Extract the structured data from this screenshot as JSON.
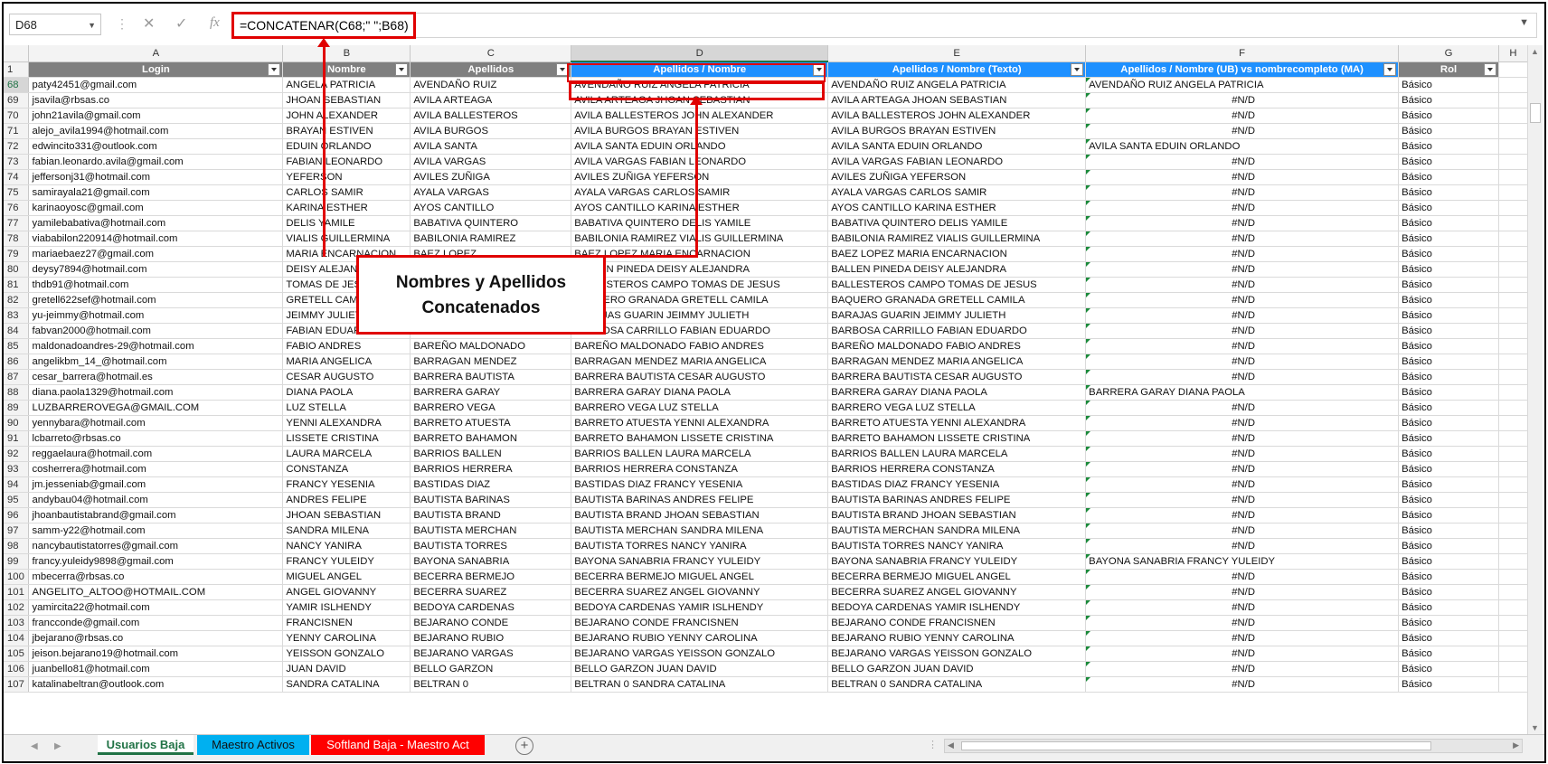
{
  "formula_bar": {
    "name_box": "D68",
    "formula": "=CONCATENAR(C68;\" \";B68)",
    "fx_label": "fx",
    "cancel_glyph": "✕",
    "enter_glyph": "✓"
  },
  "columns": [
    "A",
    "B",
    "C",
    "D",
    "E",
    "F",
    "G",
    "H"
  ],
  "selected_column": "D",
  "header_row": {
    "row_num": "1",
    "cells": [
      "Login",
      "Nombre",
      "Apellidos",
      "Apellidos / Nombre",
      "Apellidos / Nombre (Texto)",
      "Apellidos / Nombre (UB) vs nombrecompleto (MA)",
      "Rol"
    ]
  },
  "rows": [
    {
      "n": "68",
      "a": "paty42451@gmail.com",
      "b": "ANGELA PATRICIA",
      "c": "AVENDAÑO RUIZ",
      "d": "AVENDAÑO RUIZ ANGELA PATRICIA",
      "e": "AVENDAÑO RUIZ ANGELA PATRICIA",
      "f": "AVENDAÑO RUIZ ANGELA PATRICIA",
      "g": "Básico"
    },
    {
      "n": "69",
      "a": "jsavila@rbsas.co",
      "b": "JHOAN SEBASTIAN",
      "c": "AVILA ARTEAGA",
      "d": "AVILA ARTEAGA JHOAN SEBASTIAN",
      "e": "AVILA ARTEAGA JHOAN SEBASTIAN",
      "f": "#N/D",
      "g": "Básico"
    },
    {
      "n": "70",
      "a": "john21avila@gmail.com",
      "b": "JOHN ALEXANDER",
      "c": "AVILA BALLESTEROS",
      "d": "AVILA BALLESTEROS JOHN ALEXANDER",
      "e": "AVILA BALLESTEROS JOHN ALEXANDER",
      "f": "#N/D",
      "g": "Básico"
    },
    {
      "n": "71",
      "a": "alejo_avila1994@hotmail.com",
      "b": "BRAYAN ESTIVEN",
      "c": "AVILA BURGOS",
      "d": "AVILA BURGOS BRAYAN ESTIVEN",
      "e": "AVILA BURGOS BRAYAN ESTIVEN",
      "f": "#N/D",
      "g": "Básico"
    },
    {
      "n": "72",
      "a": "edwincito331@outlook.com",
      "b": "EDUIN ORLANDO",
      "c": "AVILA SANTA",
      "d": "AVILA SANTA EDUIN ORLANDO",
      "e": "AVILA SANTA EDUIN ORLANDO",
      "f": "AVILA SANTA EDUIN ORLANDO",
      "g": "Básico"
    },
    {
      "n": "73",
      "a": "fabian.leonardo.avila@gmail.com",
      "b": "FABIAN LEONARDO",
      "c": "AVILA VARGAS",
      "d": "AVILA VARGAS FABIAN LEONARDO",
      "e": "AVILA VARGAS FABIAN LEONARDO",
      "f": "#N/D",
      "g": "Básico"
    },
    {
      "n": "74",
      "a": "jeffersonj31@hotmail.com",
      "b": "YEFERSON",
      "c": "AVILES ZUÑIGA",
      "d": "AVILES ZUÑIGA YEFERSON",
      "e": "AVILES ZUÑIGA YEFERSON",
      "f": "#N/D",
      "g": "Básico"
    },
    {
      "n": "75",
      "a": "samirayala21@gmail.com",
      "b": "CARLOS SAMIR",
      "c": "AYALA VARGAS",
      "d": "AYALA VARGAS CARLOS SAMIR",
      "e": "AYALA VARGAS CARLOS SAMIR",
      "f": "#N/D",
      "g": "Básico"
    },
    {
      "n": "76",
      "a": "karinaoyosc@gmail.com",
      "b": "KARINA ESTHER",
      "c": "AYOS CANTILLO",
      "d": "AYOS CANTILLO KARINA  ESTHER",
      "e": "AYOS CANTILLO KARINA  ESTHER",
      "f": "#N/D",
      "g": "Básico"
    },
    {
      "n": "77",
      "a": "yamilebabativa@hotmail.com",
      "b": "DELIS YAMILE",
      "c": "BABATIVA QUINTERO",
      "d": "BABATIVA QUINTERO DELIS YAMILE",
      "e": "BABATIVA QUINTERO DELIS YAMILE",
      "f": "#N/D",
      "g": "Básico"
    },
    {
      "n": "78",
      "a": "viababilon220914@hotmail.com",
      "b": "VIALIS GUILLERMINA",
      "c": "BABILONIA RAMIREZ",
      "d": "BABILONIA RAMIREZ VIALIS GUILLERMINA",
      "e": "BABILONIA RAMIREZ VIALIS GUILLERMINA",
      "f": "#N/D",
      "g": "Básico"
    },
    {
      "n": "79",
      "a": "mariaebaez27@gmail.com",
      "b": "MARIA ENCARNACION",
      "c": "BAEZ LOPEZ",
      "d": "BAEZ LOPEZ MARIA ENCARNACION",
      "e": "BAEZ LOPEZ MARIA ENCARNACION",
      "f": "#N/D",
      "g": "Básico"
    },
    {
      "n": "80",
      "a": "deysy7894@hotmail.com",
      "b": "DEISY ALEJANDRA",
      "c": "BALLEN PINEDA",
      "d": "BALLEN PINEDA DEISY ALEJANDRA",
      "e": "BALLEN PINEDA DEISY ALEJANDRA",
      "f": "#N/D",
      "g": "Básico"
    },
    {
      "n": "81",
      "a": "thdb91@hotmail.com",
      "b": "TOMAS DE JESUS",
      "c": "BALLESTEROS CAMPO",
      "d": "BALLESTEROS CAMPO TOMAS DE JESUS",
      "e": "BALLESTEROS CAMPO TOMAS DE JESUS",
      "f": "#N/D",
      "g": "Básico"
    },
    {
      "n": "82",
      "a": "gretell622sef@hotmail.com",
      "b": "GRETELL CAMILA",
      "c": "BAQUERO GRANADA",
      "d": "BAQUERO GRANADA GRETELL CAMILA",
      "e": "BAQUERO GRANADA GRETELL CAMILA",
      "f": "#N/D",
      "g": "Básico"
    },
    {
      "n": "83",
      "a": "yu-jeimmy@hotmail.com",
      "b": "JEIMMY JULIETH",
      "c": "BARAJAS GUARIN",
      "d": "BARAJAS GUARIN JEIMMY JULIETH",
      "e": "BARAJAS GUARIN JEIMMY JULIETH",
      "f": "#N/D",
      "g": "Básico"
    },
    {
      "n": "84",
      "a": "fabvan2000@hotmail.com",
      "b": "FABIAN EDUARDO",
      "c": "BARBOSA CARRILLO",
      "d": "BARBOSA CARRILLO FABIAN EDUARDO",
      "e": "BARBOSA CARRILLO FABIAN EDUARDO",
      "f": "#N/D",
      "g": "Básico"
    },
    {
      "n": "85",
      "a": "maldonadoandres-29@hotmail.com",
      "b": "FABIO ANDRES",
      "c": "BAREÑO MALDONADO",
      "d": "BAREÑO MALDONADO FABIO ANDRES",
      "e": "BAREÑO MALDONADO FABIO ANDRES",
      "f": "#N/D",
      "g": "Básico"
    },
    {
      "n": "86",
      "a": "angelikbm_14_@hotmail.com",
      "b": "MARIA ANGELICA",
      "c": "BARRAGAN MENDEZ",
      "d": "BARRAGAN MENDEZ MARIA ANGELICA",
      "e": "BARRAGAN MENDEZ MARIA ANGELICA",
      "f": "#N/D",
      "g": "Básico"
    },
    {
      "n": "87",
      "a": "cesar_barrera@hotmail.es",
      "b": "CESAR AUGUSTO",
      "c": "BARRERA BAUTISTA",
      "d": "BARRERA BAUTISTA CESAR AUGUSTO",
      "e": "BARRERA BAUTISTA CESAR AUGUSTO",
      "f": "#N/D",
      "g": "Básico"
    },
    {
      "n": "88",
      "a": "diana.paola1329@hotmail.com",
      "b": "DIANA PAOLA",
      "c": "BARRERA GARAY",
      "d": "BARRERA GARAY DIANA PAOLA",
      "e": "BARRERA GARAY DIANA PAOLA",
      "f": "BARRERA GARAY DIANA PAOLA",
      "g": "Básico"
    },
    {
      "n": "89",
      "a": "LUZBARREROVEGA@GMAIL.COM",
      "b": "LUZ STELLA",
      "c": "BARRERO VEGA",
      "d": "BARRERO VEGA LUZ STELLA",
      "e": "BARRERO VEGA LUZ STELLA",
      "f": "#N/D",
      "g": "Básico"
    },
    {
      "n": "90",
      "a": "yennybara@hotmail.com",
      "b": "YENNI  ALEXANDRA",
      "c": "BARRETO ATUESTA",
      "d": "BARRETO ATUESTA YENNI  ALEXANDRA",
      "e": "BARRETO ATUESTA YENNI  ALEXANDRA",
      "f": "#N/D",
      "g": "Básico"
    },
    {
      "n": "91",
      "a": "lcbarreto@rbsas.co",
      "b": "LISSETE CRISTINA",
      "c": "BARRETO BAHAMON",
      "d": "BARRETO BAHAMON LISSETE CRISTINA",
      "e": "BARRETO BAHAMON LISSETE CRISTINA",
      "f": "#N/D",
      "g": "Básico"
    },
    {
      "n": "92",
      "a": "reggaelaura@hotmail.com",
      "b": "LAURA  MARCELA",
      "c": "BARRIOS BALLEN",
      "d": "BARRIOS BALLEN LAURA  MARCELA",
      "e": "BARRIOS BALLEN LAURA  MARCELA",
      "f": "#N/D",
      "g": "Básico"
    },
    {
      "n": "93",
      "a": "cosherrera@hotmail.com",
      "b": "CONSTANZA",
      "c": "BARRIOS HERRERA",
      "d": "BARRIOS HERRERA CONSTANZA",
      "e": "BARRIOS HERRERA CONSTANZA",
      "f": "#N/D",
      "g": "Básico"
    },
    {
      "n": "94",
      "a": "jm.jesseniab@gmail.com",
      "b": "FRANCY YESENIA",
      "c": "BASTIDAS DIAZ",
      "d": "BASTIDAS DIAZ FRANCY YESENIA",
      "e": "BASTIDAS DIAZ FRANCY YESENIA",
      "f": "#N/D",
      "g": "Básico"
    },
    {
      "n": "95",
      "a": "andybau04@hotmail.com",
      "b": "ANDRES FELIPE",
      "c": "BAUTISTA BARINAS",
      "d": "BAUTISTA BARINAS ANDRES FELIPE",
      "e": "BAUTISTA BARINAS ANDRES FELIPE",
      "f": "#N/D",
      "g": "Básico"
    },
    {
      "n": "96",
      "a": "jhoanbautistabrand@gmail.com",
      "b": "JHOAN SEBASTIAN",
      "c": "BAUTISTA BRAND",
      "d": "BAUTISTA BRAND JHOAN SEBASTIAN",
      "e": "BAUTISTA BRAND JHOAN SEBASTIAN",
      "f": "#N/D",
      "g": "Básico"
    },
    {
      "n": "97",
      "a": "samm-y22@hotmail.com",
      "b": "SANDRA MILENA",
      "c": "BAUTISTA MERCHAN",
      "d": "BAUTISTA MERCHAN SANDRA MILENA",
      "e": "BAUTISTA MERCHAN SANDRA MILENA",
      "f": "#N/D",
      "g": "Básico"
    },
    {
      "n": "98",
      "a": "nancybautistatorres@gmail.com",
      "b": "NANCY  YANIRA",
      "c": "BAUTISTA TORRES",
      "d": "BAUTISTA TORRES NANCY  YANIRA",
      "e": "BAUTISTA TORRES NANCY  YANIRA",
      "f": "#N/D",
      "g": "Básico"
    },
    {
      "n": "99",
      "a": "francy.yuleidy9898@gmail.com",
      "b": "FRANCY YULEIDY",
      "c": "BAYONA SANABRIA",
      "d": "BAYONA SANABRIA FRANCY YULEIDY",
      "e": "BAYONA SANABRIA FRANCY YULEIDY",
      "f": "BAYONA SANABRIA FRANCY YULEIDY",
      "g": "Básico"
    },
    {
      "n": "100",
      "a": "mbecerra@rbsas.co",
      "b": "MIGUEL ANGEL",
      "c": "BECERRA BERMEJO",
      "d": "BECERRA BERMEJO MIGUEL ANGEL",
      "e": "BECERRA BERMEJO MIGUEL ANGEL",
      "f": "#N/D",
      "g": "Básico"
    },
    {
      "n": "101",
      "a": "ANGELITO_ALTOO@HOTMAIL.COM",
      "b": "ANGEL GIOVANNY",
      "c": "BECERRA SUAREZ",
      "d": "BECERRA SUAREZ ANGEL GIOVANNY",
      "e": "BECERRA SUAREZ ANGEL GIOVANNY",
      "f": "#N/D",
      "g": "Básico"
    },
    {
      "n": "102",
      "a": "yamircita22@hotmail.com",
      "b": "YAMIR ISLHENDY",
      "c": "BEDOYA CARDENAS",
      "d": "BEDOYA CARDENAS YAMIR ISLHENDY",
      "e": "BEDOYA CARDENAS YAMIR ISLHENDY",
      "f": "#N/D",
      "g": "Básico"
    },
    {
      "n": "103",
      "a": "francconde@gmail.com",
      "b": "FRANCISNEN",
      "c": "BEJARANO CONDE",
      "d": "BEJARANO CONDE FRANCISNEN",
      "e": "BEJARANO CONDE FRANCISNEN",
      "f": "#N/D",
      "g": "Básico"
    },
    {
      "n": "104",
      "a": "jbejarano@rbsas.co",
      "b": "YENNY CAROLINA",
      "c": "BEJARANO RUBIO",
      "d": "BEJARANO RUBIO YENNY CAROLINA",
      "e": "BEJARANO RUBIO YENNY CAROLINA",
      "f": "#N/D",
      "g": "Básico"
    },
    {
      "n": "105",
      "a": "jeison.bejarano19@hotmail.com",
      "b": "YEISSON GONZALO",
      "c": "BEJARANO VARGAS",
      "d": "BEJARANO VARGAS YEISSON GONZALO",
      "e": "BEJARANO VARGAS YEISSON GONZALO",
      "f": "#N/D",
      "g": "Básico"
    },
    {
      "n": "106",
      "a": "juanbello81@hotmail.com",
      "b": "JUAN DAVID",
      "c": "BELLO GARZON",
      "d": "BELLO GARZON JUAN DAVID",
      "e": "BELLO GARZON JUAN DAVID",
      "f": "#N/D",
      "g": "Básico"
    },
    {
      "n": "107",
      "a": "katalinabeltran@outlook.com",
      "b": "SANDRA CATALINA",
      "c": "BELTRAN 0",
      "d": "BELTRAN 0 SANDRA CATALINA",
      "e": "BELTRAN 0 SANDRA CATALINA",
      "f": "#N/D",
      "g": "Básico"
    }
  ],
  "callout": {
    "line1": "Nombres y Apellidos",
    "line2": "Concatenados"
  },
  "sheet_tabs": [
    {
      "label": "Usuarios Baja",
      "color": "#ffffff",
      "active": true
    },
    {
      "label": "Maestro Activos",
      "color": "#00b0f0",
      "active": false
    },
    {
      "label": "Softland Baja - Maestro Act",
      "color": "#ff0000",
      "active": false
    }
  ],
  "colors": {
    "accent_red": "#e00000",
    "excel_green": "#217346",
    "header_gray": "#7f7f7f",
    "header_blue": "#1e90ff"
  }
}
